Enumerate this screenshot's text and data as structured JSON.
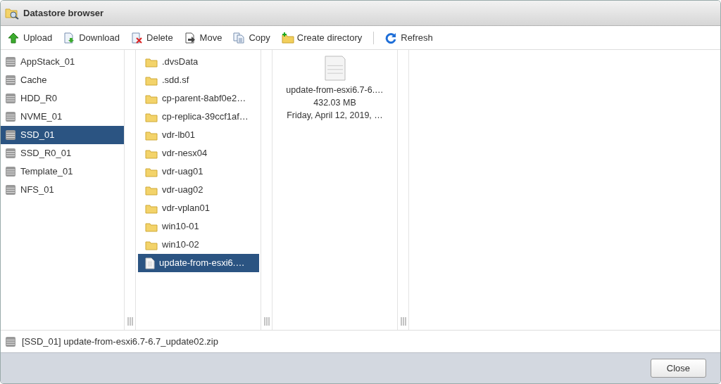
{
  "window": {
    "title": "Datastore browser"
  },
  "toolbar": {
    "groups": [
      [
        {
          "label": "Upload",
          "kind": "upload"
        },
        {
          "label": "Download",
          "kind": "download"
        },
        {
          "label": "Delete",
          "kind": "delete"
        },
        {
          "label": "Move",
          "kind": "move"
        },
        {
          "label": "Copy",
          "kind": "copy"
        },
        {
          "label": "Create directory",
          "kind": "mkdir"
        }
      ],
      [
        {
          "label": "Refresh",
          "kind": "refresh"
        }
      ]
    ]
  },
  "datastores": [
    {
      "name": "AppStack_01",
      "selected": false
    },
    {
      "name": "Cache",
      "selected": false
    },
    {
      "name": "HDD_R0",
      "selected": false
    },
    {
      "name": "NVME_01",
      "selected": false
    },
    {
      "name": "SSD_01",
      "selected": true
    },
    {
      "name": "SSD_R0_01",
      "selected": false
    },
    {
      "name": "Template_01",
      "selected": false
    },
    {
      "name": "NFS_01",
      "selected": false
    }
  ],
  "files": [
    {
      "name": ".dvsData",
      "kind": "folder",
      "selected": false
    },
    {
      "name": ".sdd.sf",
      "kind": "folder",
      "selected": false
    },
    {
      "name": "cp-parent-8abf0e2…",
      "kind": "folder",
      "selected": false
    },
    {
      "name": "cp-replica-39ccf1af…",
      "kind": "folder",
      "selected": false
    },
    {
      "name": "vdr-lb01",
      "kind": "folder",
      "selected": false
    },
    {
      "name": "vdr-nesx04",
      "kind": "folder",
      "selected": false
    },
    {
      "name": "vdr-uag01",
      "kind": "folder",
      "selected": false
    },
    {
      "name": "vdr-uag02",
      "kind": "folder",
      "selected": false
    },
    {
      "name": "vdr-vplan01",
      "kind": "folder",
      "selected": false
    },
    {
      "name": "win10-01",
      "kind": "folder",
      "selected": false
    },
    {
      "name": "win10-02",
      "kind": "folder",
      "selected": false
    },
    {
      "name": "update-from-esxi6.…",
      "kind": "file",
      "selected": true
    }
  ],
  "details": {
    "name": "update-from-esxi6.7-6.…",
    "size": "432.03 MB",
    "date": "Friday, April 12, 2019, …"
  },
  "status_bar": {
    "path": "[SSD_01] update-from-esxi6.7-6.7_update02.zip"
  },
  "buttons": [
    {
      "label": "Close"
    }
  ]
}
